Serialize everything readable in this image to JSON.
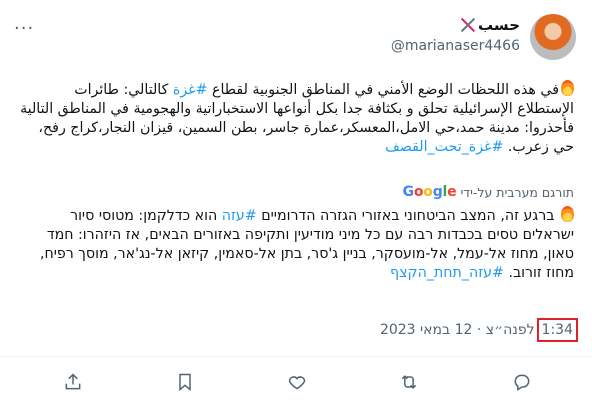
{
  "user": {
    "display_name": "حسب",
    "handle": "@marianaser4466"
  },
  "tweet": {
    "arabic_line1": "في هذه اللحظات الوضع الأمني في المناطق الجنوبية لقطاع",
    "arabic_hashtag1": "#غزة",
    "arabic_line1_end": "كالتالي:",
    "arabic_body": "طائرات الإستطلاع الإسرائيلية تحلق و بكثافة جدا بكل أنواعها الاستخباراتية والهجومية في المناطق التالية فأحذروا: مدينة حمد،حي الامل،المعسكر،عمارة جاسر، بطن السمين، قيزان النجار،كراج رفح، حي زعرب.",
    "arabic_hashtag2": "#غزة_تحت_القصف",
    "translated_by": "תורגם מערבית על-ידי",
    "google_word": "Google",
    "hebrew_line1": "ברגע זה, המצב הביטחוני באזורי הגזרה הדרומיים",
    "hebrew_hashtag1": "#עזה",
    "hebrew_line1_end": "הוא כדלקמן:",
    "hebrew_body": "מטוסי סיור ישראלים טסים בכבדות רבה עם כל מיני מודיעין ותקיפה באזורים הבאים, אז היזהרו: חמד טאון, מחוז אל-עמל, אל-מועסקר, בניין ג'סר, בתן אל-סאמין, קיזאן אל-נג'אר, מוסך רפיח, מחוז זורוב.",
    "hebrew_hashtag2": "#עזה_תחת_הקצף"
  },
  "timestamp": {
    "time": "1:34",
    "rest": "לפנה״צ · 12 במאי 2023"
  },
  "actions": {
    "reply": "reply-icon",
    "retweet": "retweet-icon",
    "like": "heart-icon",
    "bookmark": "bookmark-icon",
    "share": "share-icon"
  },
  "colors": {
    "link": "#1d9bf0",
    "highlight_box": "#e0202a",
    "muted": "#536471"
  }
}
